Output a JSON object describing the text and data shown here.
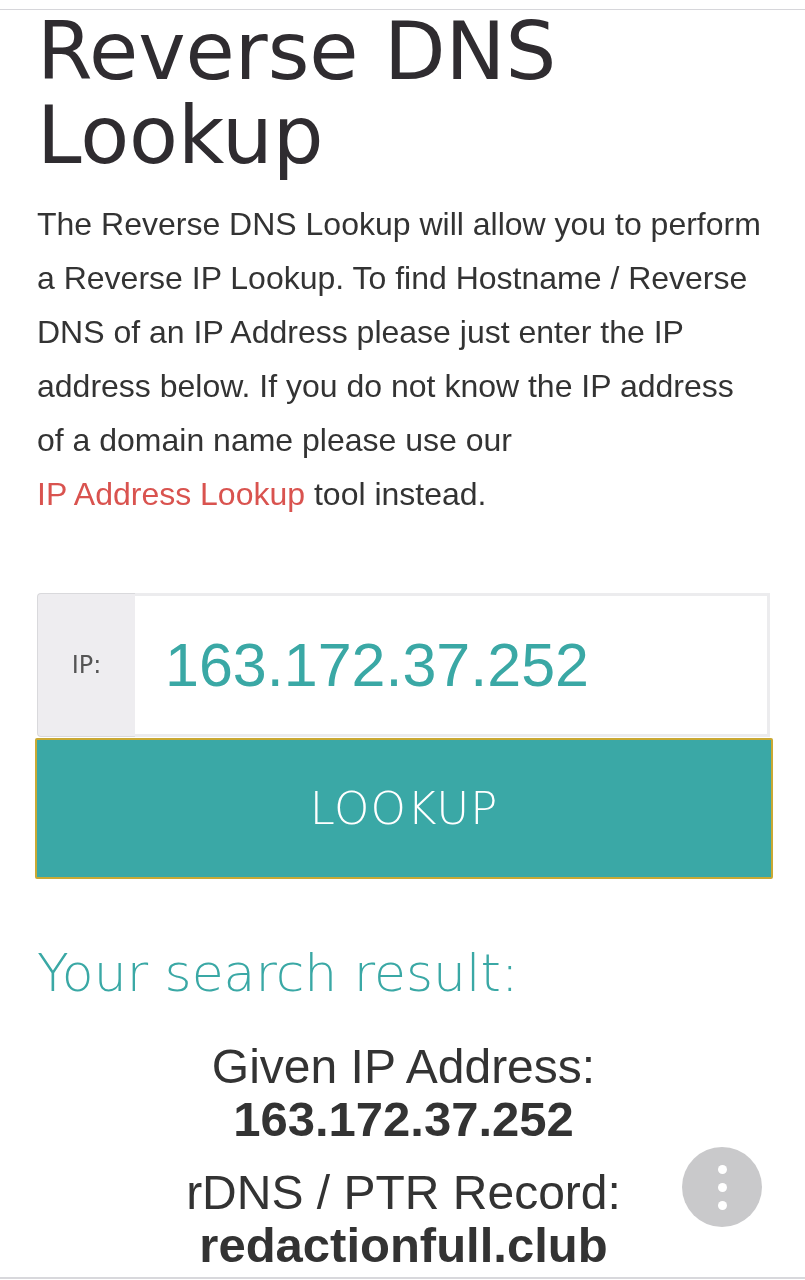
{
  "heading": "Reverse DNS Lookup",
  "intro": {
    "before": "The Reverse DNS Lookup will allow you to perform a Reverse IP Lookup. To find Hostname / Reverse DNS of an IP Address please just enter the IP address below. If you do not know the IP address of a domain name please use our ",
    "link": "IP Address Lookup",
    "after": " tool instead."
  },
  "form": {
    "label": "IP:",
    "value": "163.172.37.252",
    "button": "LOOKUP"
  },
  "result": {
    "title": "Your search result:",
    "items": [
      {
        "label": "Given IP Address:",
        "value": "163.172.37.252"
      },
      {
        "label": "rDNS / PTR Record:",
        "value": "redactionfull.club"
      }
    ]
  }
}
